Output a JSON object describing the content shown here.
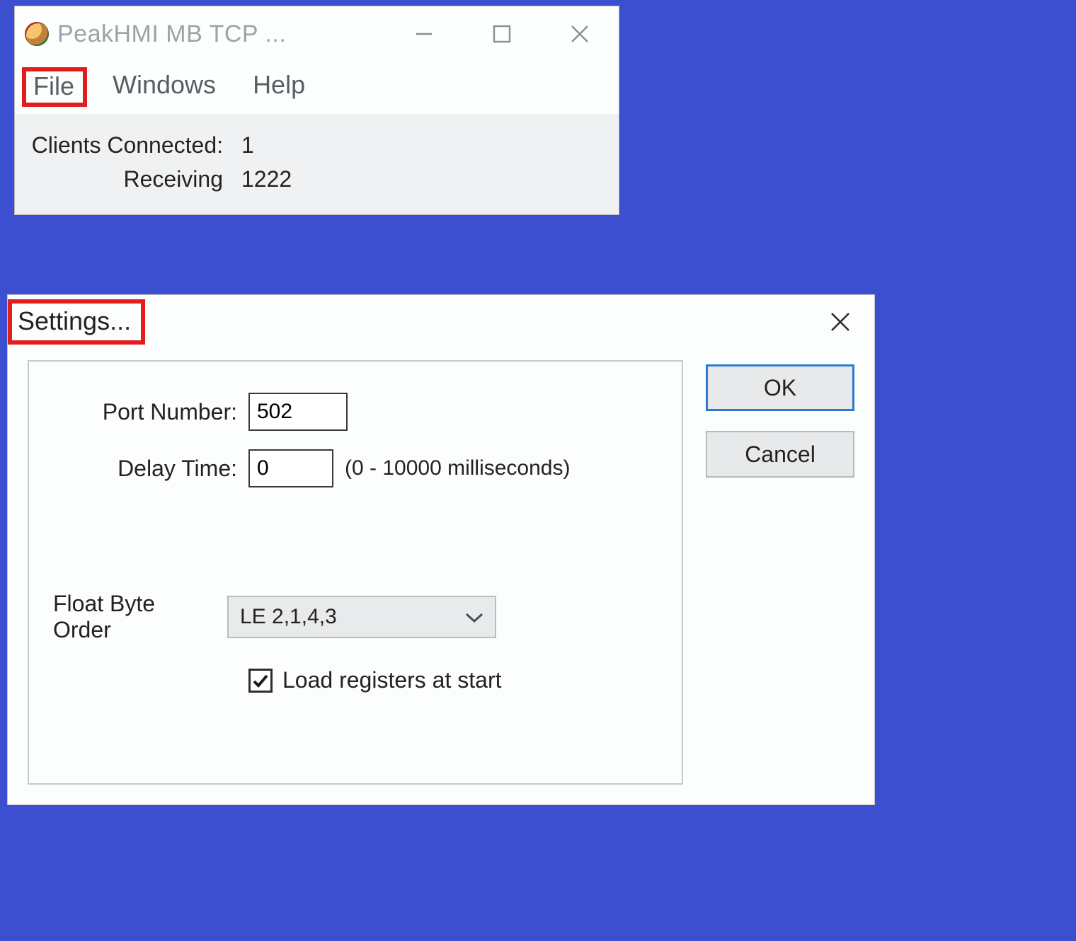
{
  "main": {
    "title": "PeakHMI MB TCP ...",
    "menu": {
      "file": "File",
      "windows": "Windows",
      "help": "Help"
    },
    "status": {
      "clients_label": "Clients Connected:",
      "clients_value": "1",
      "recv_label": "Receiving",
      "recv_value": "1222"
    }
  },
  "dialog": {
    "title": "Settings...",
    "port_label": "Port Number:",
    "port_value": "502",
    "delay_label": "Delay Time:",
    "delay_value": "0",
    "delay_hint": "(0 - 10000 milliseconds)",
    "float_label": "Float Byte Order",
    "float_value": "LE 2,1,4,3",
    "load_label": "Load registers at start",
    "load_checked": true,
    "ok": "OK",
    "cancel": "Cancel"
  }
}
